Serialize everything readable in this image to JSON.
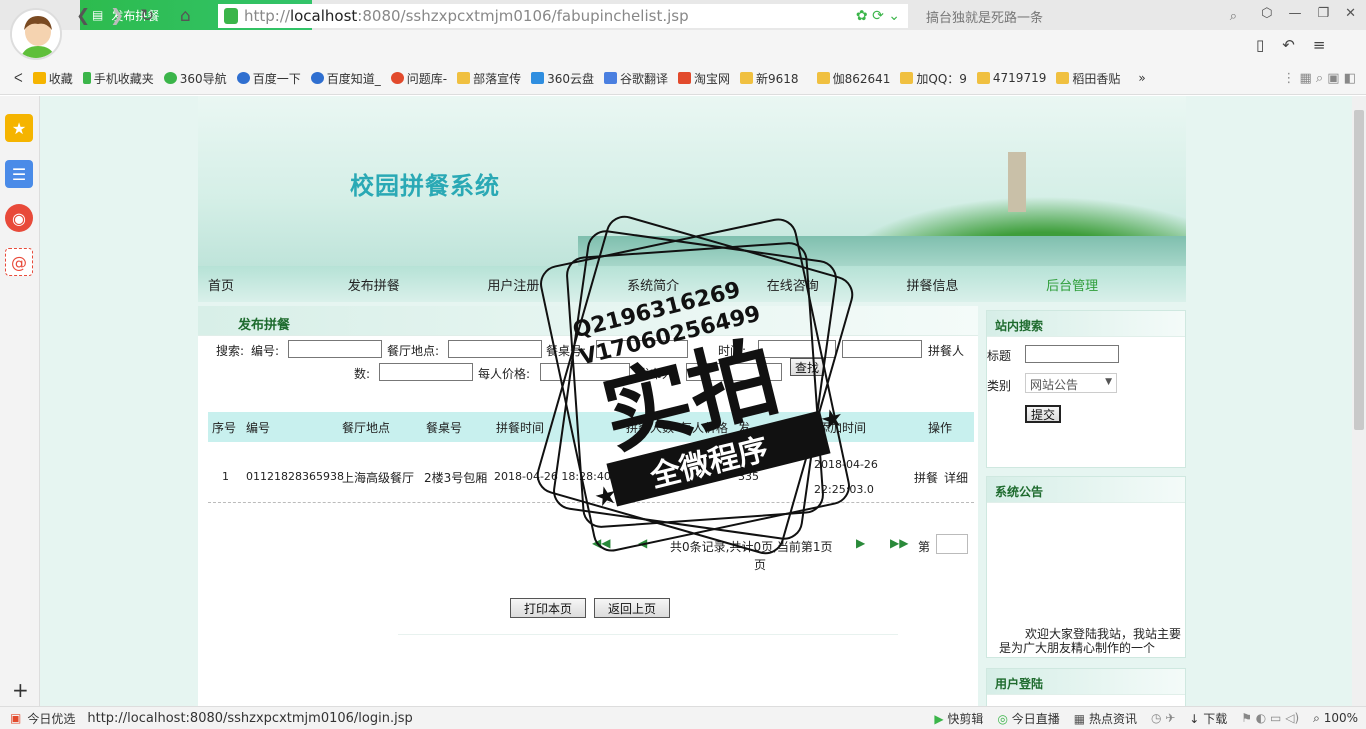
{
  "browser": {
    "tab_title": "发布拼餐",
    "tab_close": "×",
    "new_tab": "+",
    "url_scheme": "http://",
    "url_host": "localhost",
    "url_rest": ":8080/sshzxpcxtmjm0106/fabupinchelist.jsp",
    "search_text": "搞台独就是死路一条",
    "status_url": "http://localhost:8080/sshzxpcxtmjm0106/login.jsp",
    "status_left": "今日优选",
    "status_items": [
      "快剪辑",
      "今日直播",
      "热点资讯",
      "下载"
    ],
    "zoom": "100%"
  },
  "bookmarks": [
    "收藏",
    "手机收藏夹",
    "360导航",
    "百度一下",
    "百度知道_",
    "问题库-",
    "部落宣传",
    "360云盘",
    "谷歌翻译",
    "淘宝网",
    "新9618",
    "伽862641",
    "加QQ：9",
    "4719719",
    "稻田香贴"
  ],
  "bookmark_more": "»",
  "site": {
    "title": "校园拼餐系统"
  },
  "menu": [
    "首页",
    "发布拼餐",
    "用户注册",
    "系统简介",
    "在线咨询",
    "拼餐信息",
    "后台管理"
  ],
  "main": {
    "heading": "发布拼餐",
    "search_label": "搜索:",
    "f_bianhao": "编号:",
    "f_didian": "餐厅地点:",
    "f_canzhuo": "餐桌号:",
    "f_shijian": "时间:",
    "f_renshu_a": "拼餐人",
    "f_renshu_b": "数:",
    "f_jiage": "每人价格:",
    "f_faburen": "发布人:",
    "search_button": "查找",
    "columns": [
      "序号",
      "编号",
      "餐厅地点",
      "餐桌号",
      "拼餐时间",
      "拼餐人数",
      "每人价格",
      "发",
      "添加时间",
      "操作"
    ],
    "row": {
      "xuhao": "1",
      "bianhao": "01121828365938",
      "didian": "上海高级餐厅",
      "canzhuo": "2楼3号包厢",
      "shijian": "2018-04-26 18:28:40",
      "renshu": "0",
      "jiage": "335",
      "tianjia_a": "2018-04-26",
      "tianjia_b": "22:25:03.0",
      "op_pin": "拼餐",
      "op_detail": "详细"
    },
    "pager_text": "共0条记录,共计0页,当前第1页",
    "pager_text2": "页",
    "pager_go": "第",
    "print_button": "打印本页",
    "back_button": "返回上页"
  },
  "right": {
    "search_title": "站内搜索",
    "title_label": "标题",
    "type_label": "类别",
    "type_value": "网站公告",
    "submit_button": "提交",
    "notice_title": "系统公告",
    "notice_text": "欢迎大家登陆我站，我站主要是为广大朋友精心制作的一个",
    "login_title": "用户登陆"
  },
  "stamp": {
    "line1": "Q2196316269",
    "line2": "V17060256499",
    "big": "实拍",
    "ribbon": "全微程序"
  }
}
